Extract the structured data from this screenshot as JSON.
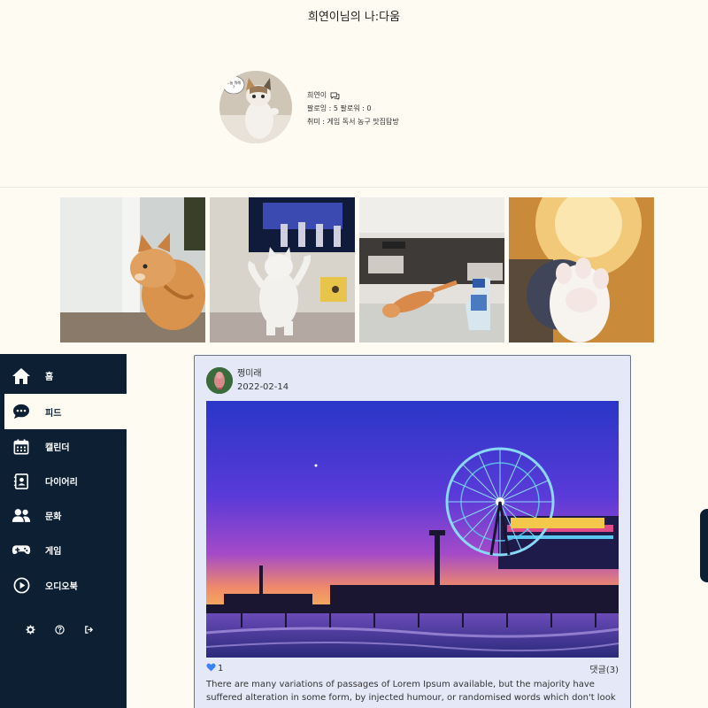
{
  "site": {
    "title": "희연이님의 나:다움"
  },
  "profile": {
    "name": "희연이",
    "follow_stats": "팔로잉 : 5  팔로워 : 0",
    "hobbies": "취미 : 게임 독서 농구 맛집탐방",
    "avatar_caption": "오늘 뭐해?"
  },
  "gallery": [
    "cat-at-window",
    "dancing-white-cat",
    "cat-stretching-on-floor",
    "cat-paw-in-light"
  ],
  "sidebar": {
    "items": [
      {
        "label": "홈",
        "icon": "home-icon"
      },
      {
        "label": "피드",
        "icon": "chat-bubble-icon",
        "active": true
      },
      {
        "label": "캘린더",
        "icon": "calendar-icon"
      },
      {
        "label": "다이어리",
        "icon": "contact-book-icon"
      },
      {
        "label": "문화",
        "icon": "users-icon"
      },
      {
        "label": "게임",
        "icon": "gamepad-icon"
      },
      {
        "label": "오디오북",
        "icon": "play-circle-icon"
      }
    ],
    "bottom_icons": [
      "gear-icon",
      "help-icon",
      "logout-icon"
    ]
  },
  "post": {
    "author": "쩡미래",
    "date": "2022-02-14",
    "likes": "1",
    "comments": "댓글(3)",
    "body": "There are many variations of passages of Lorem Ipsum available, but the majority have suffered alteration in some form, by injected humour, or randomised words which don't look"
  },
  "colors": {
    "sidebar": "#0c1f33",
    "page": "#fefbf2",
    "post_bg": "#e4e8f7",
    "like": "#3b82f6"
  }
}
